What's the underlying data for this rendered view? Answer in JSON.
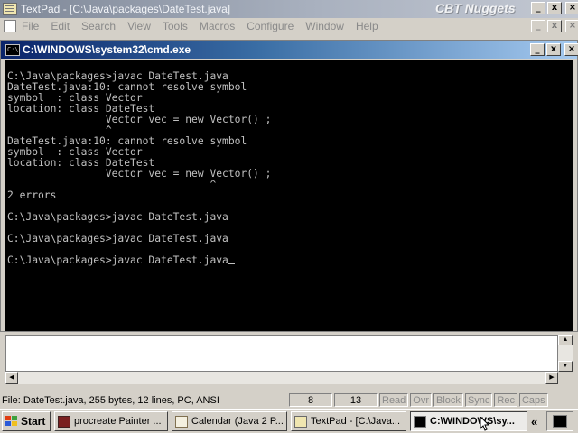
{
  "textpad": {
    "title": "TextPad - [C:\\Java\\packages\\DateTest.java]",
    "brand_watermark": "CBT Nuggets",
    "menu": [
      "File",
      "Edit",
      "Search",
      "View",
      "Tools",
      "Macros",
      "Configure",
      "Window",
      "Help"
    ],
    "window_buttons": {
      "minimize": "_",
      "restore": "х",
      "close": "×"
    }
  },
  "cmd": {
    "title": "C:\\WINDOWS\\system32\\cmd.exe",
    "icon_label": "C:\\",
    "lines": [
      "C:\\Java\\packages>javac DateTest.java",
      "DateTest.java:10: cannot resolve symbol",
      "symbol  : class Vector",
      "location: class DateTest",
      "                Vector vec = new Vector() ;",
      "                ^",
      "DateTest.java:10: cannot resolve symbol",
      "symbol  : class Vector",
      "location: class DateTest",
      "                Vector vec = new Vector() ;",
      "                                 ^",
      "2 errors",
      "",
      "C:\\Java\\packages>javac DateTest.java",
      "",
      "C:\\Java\\packages>javac DateTest.java",
      "",
      "C:\\Java\\packages>javac DateTest.java"
    ]
  },
  "statusbar": {
    "file_info": "File: DateTest.java, 255 bytes, 12 lines, PC, ANSI",
    "line": "8",
    "column": "13",
    "flags": [
      "Read",
      "Ovr",
      "Block",
      "Sync",
      "Rec",
      "Caps"
    ]
  },
  "taskbar": {
    "start_label": "Start",
    "tasks": [
      {
        "label": "procreate Painter ...",
        "active": false,
        "icon": "painter-icon"
      },
      {
        "label": "Calendar (Java 2 P...",
        "active": false,
        "icon": "calendar-icon"
      },
      {
        "label": "TextPad - [C:\\Java...",
        "active": false,
        "icon": "textpad-icon"
      },
      {
        "label": "C:\\WINDOWS\\sy...",
        "active": true,
        "icon": "cmd-icon"
      }
    ],
    "tray_arrow": "«"
  },
  "colors": {
    "console_bg": "#000000",
    "console_fg": "#c0c0c0",
    "cmd_title_start": "#0a246a",
    "cmd_title_end": "#a6caf0",
    "inactive_title": "#7f8898"
  }
}
